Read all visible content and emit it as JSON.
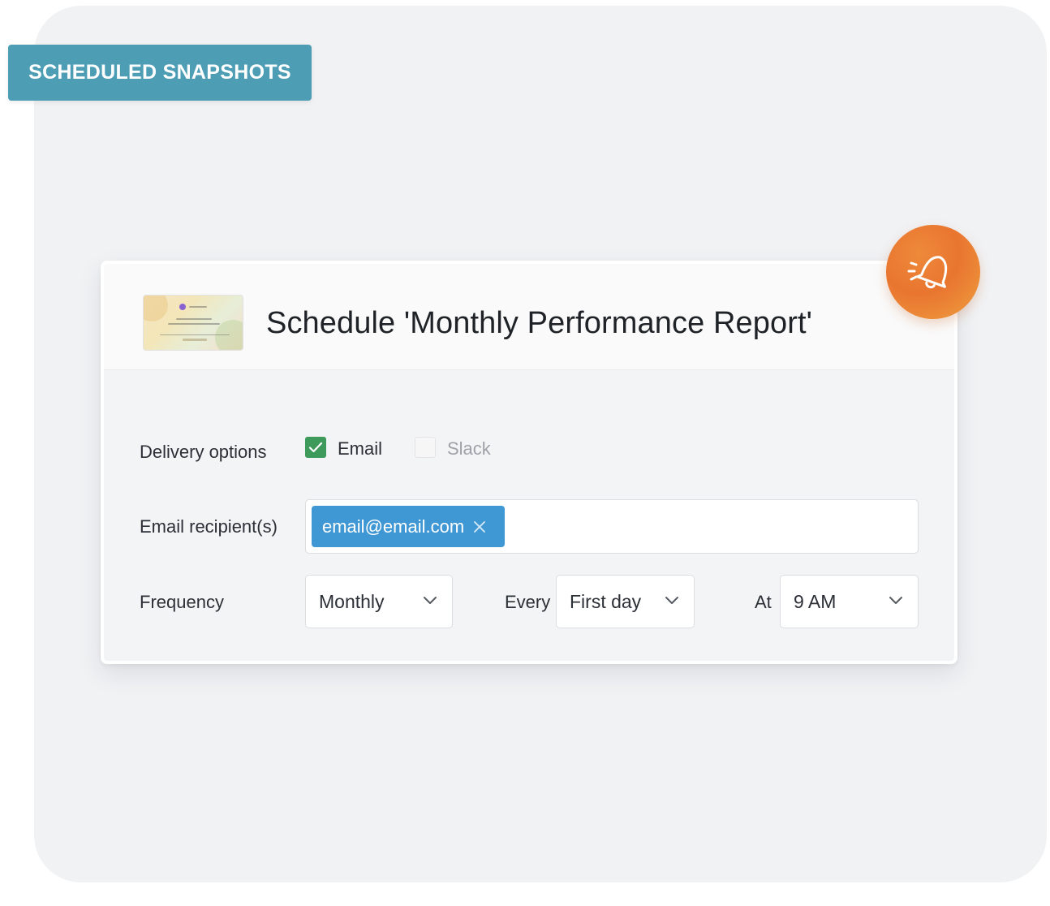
{
  "badge": {
    "label": "SCHEDULED SNAPSHOTS"
  },
  "dialog": {
    "title": "Schedule 'Monthly Performance Report'",
    "thumbnail_icon": "report-thumbnail"
  },
  "delivery": {
    "label": "Delivery options",
    "options": [
      {
        "label": "Email",
        "checked": true
      },
      {
        "label": "Slack",
        "checked": false
      }
    ]
  },
  "recipients": {
    "label": "Email recipient(s)",
    "chips": [
      "email@email.com"
    ]
  },
  "frequency": {
    "label": "Frequency",
    "value": "Monthly",
    "every_label": "Every",
    "every_value": "First day",
    "at_label": "At",
    "at_value": "9 AM"
  },
  "icons": {
    "bell": "bell-ringing-icon",
    "check": "check-icon",
    "remove": "close-icon",
    "dropdown": "chevron-down-icon"
  },
  "colors": {
    "badge": "#4d9eb5",
    "chip": "#3f97d3",
    "checkbox": "#3d9a5b",
    "bell_orange": "#e9752f"
  }
}
